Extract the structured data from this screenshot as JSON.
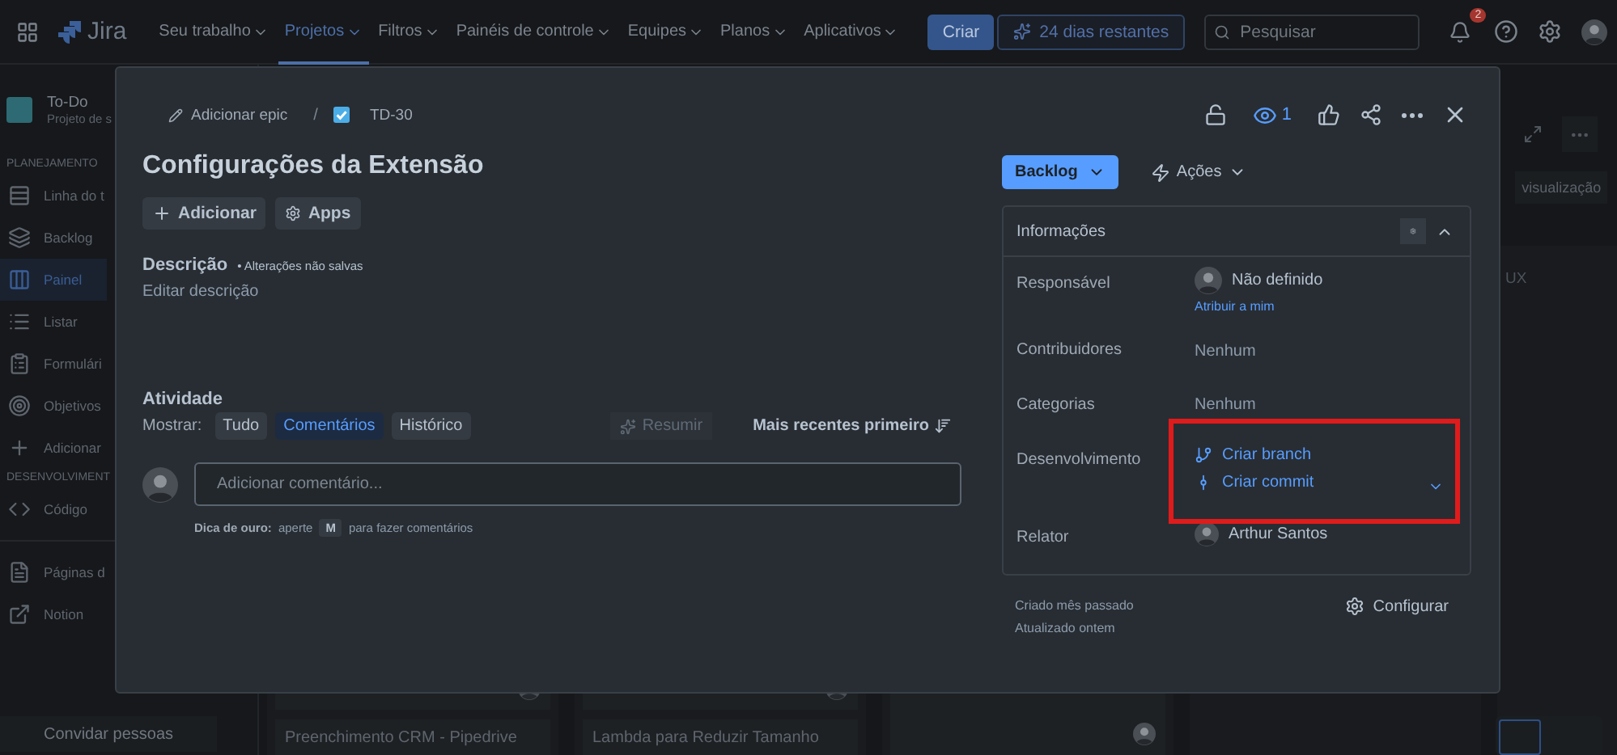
{
  "top_nav": {
    "app_name": "Jira",
    "menus": [
      {
        "label": "Seu trabalho",
        "selected": false
      },
      {
        "label": "Projetos",
        "selected": true
      },
      {
        "label": "Filtros",
        "selected": false
      },
      {
        "label": "Painéis de controle",
        "selected": false
      },
      {
        "label": "Equipes",
        "selected": false
      },
      {
        "label": "Planos",
        "selected": false
      },
      {
        "label": "Aplicativos",
        "selected": false
      }
    ],
    "create_button": "Criar",
    "trial_button": "24 dias restantes",
    "search": {
      "placeholder": "Pesquisar"
    },
    "notification_count": "2"
  },
  "sidebar": {
    "project": {
      "name": "To-Do",
      "subtitle": "Projeto de s"
    },
    "sections": [
      {
        "title": "PLANEJAMENTO",
        "items": [
          {
            "label": "Linha do t",
            "selected": false
          },
          {
            "label": "Backlog",
            "selected": false
          },
          {
            "label": "Painel",
            "selected": true
          },
          {
            "label": "Listar",
            "selected": false
          },
          {
            "label": "Formulári",
            "selected": false
          },
          {
            "label": "Objetivos",
            "selected": false
          },
          {
            "label": "Adicionar",
            "selected": false
          }
        ]
      },
      {
        "title": "DESENVOLVIMENT",
        "items": [
          {
            "label": "Código",
            "selected": false
          }
        ]
      },
      {
        "items": [
          {
            "label": "Páginas d",
            "selected": false
          },
          {
            "label": "Notion",
            "selected": false
          }
        ]
      }
    ],
    "invite_button": "Convidar pessoas"
  },
  "board": {
    "view_button": "visualização",
    "columns": [
      {
        "cards": [
          {
            "kind": "assigned"
          },
          {
            "kind": "titled",
            "title": "Preenchimento CRM - Pipedrive"
          }
        ]
      },
      {
        "cards": [
          {
            "kind": "assigned"
          },
          {
            "kind": "titled",
            "title": "Lambda para Reduzir Tamanho"
          }
        ]
      },
      {
        "cards": [
          {
            "kind": "assigned"
          }
        ]
      },
      {},
      {
        "header": "UX"
      }
    ]
  },
  "issue_modal": {
    "breadcrumb": {
      "epic_link": "Adicionar epic",
      "separator": "/",
      "issue_key": "TD-30"
    },
    "watchers": "1",
    "title": "Configurações da Extensão",
    "actions": [
      "Adicionar",
      "Apps"
    ],
    "description": {
      "label": "Descrição",
      "note": "• Alterações não salvas",
      "placeholder": "Editar descrição"
    },
    "activity": {
      "title": "Atividade",
      "show_label": "Mostrar:",
      "filters": [
        {
          "label": "Tudo",
          "selected": false
        },
        {
          "label": "Comentários",
          "selected": true
        },
        {
          "label": "Histórico",
          "selected": false
        }
      ],
      "summarize_button": {
        "label": "Resumir",
        "disabled": true
      },
      "sort_button": "Mais recentes primeiro",
      "comment": {
        "placeholder": "Adicionar comentário..."
      },
      "hint": {
        "label": "Dica de ouro:",
        "before": "aperte",
        "key": "M",
        "after": "para fazer comentários"
      }
    },
    "status_button": "Backlog",
    "actions_menu": "Ações",
    "details": {
      "title": "Informações",
      "expanded": true,
      "assignee": {
        "label": "Responsável",
        "value": "Não definido",
        "assign_link": "Atribuir a mim"
      },
      "contributors": {
        "label": "Contribuidores",
        "value": "Nenhum"
      },
      "categories": {
        "label": "Categorias",
        "value": "Nenhum"
      },
      "development": {
        "label": "Desenvolvimento",
        "links": [
          "Criar branch",
          "Criar commit"
        ],
        "highlighted": true
      },
      "reporter": {
        "label": "Relator",
        "value": "Arthur Santos"
      }
    },
    "created": "Criado mês passado",
    "updated": "Atualizado ontem",
    "configure_button": "Configurar"
  }
}
